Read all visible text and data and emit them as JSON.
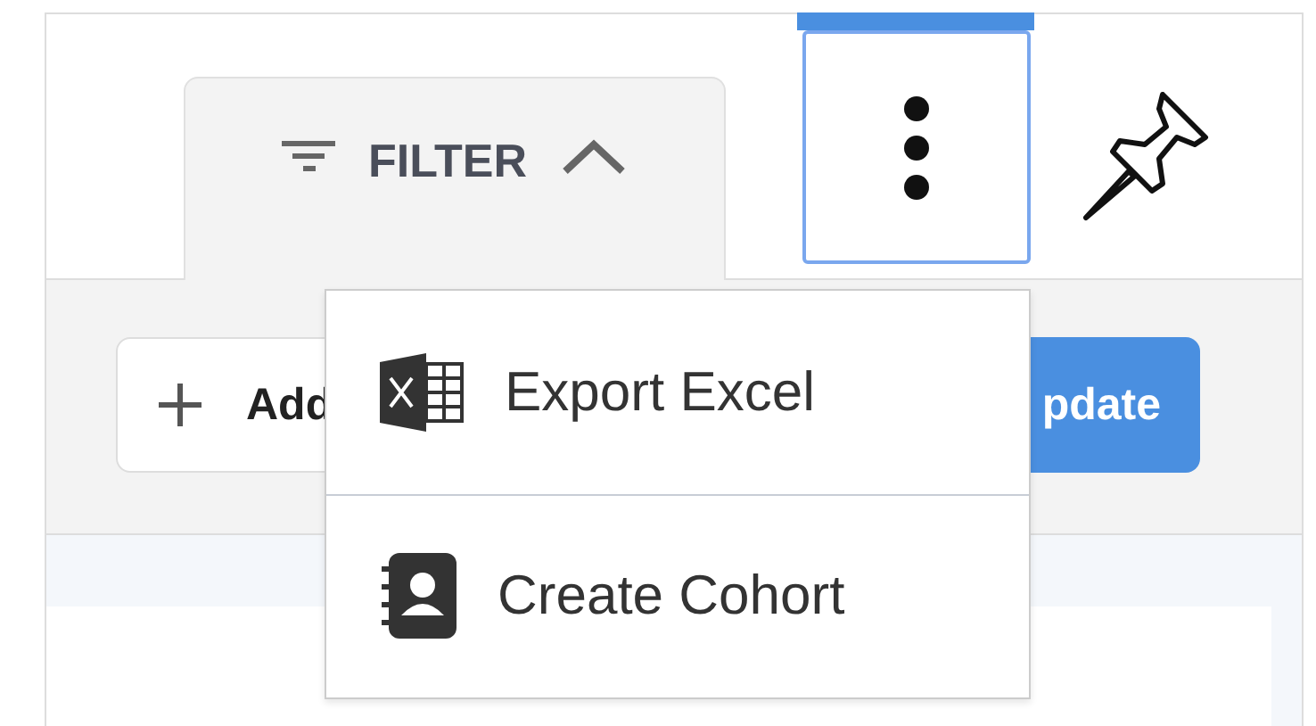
{
  "filter": {
    "label": "FILTER",
    "expanded": true
  },
  "actions": [
    {
      "label": "Add",
      "kind": "add"
    },
    {
      "label": "pdate",
      "kind": "primary"
    }
  ],
  "menu": {
    "items": [
      {
        "label": "Export Excel",
        "kind": "excel"
      },
      {
        "label": "Create Cohort",
        "kind": "contact"
      }
    ]
  }
}
